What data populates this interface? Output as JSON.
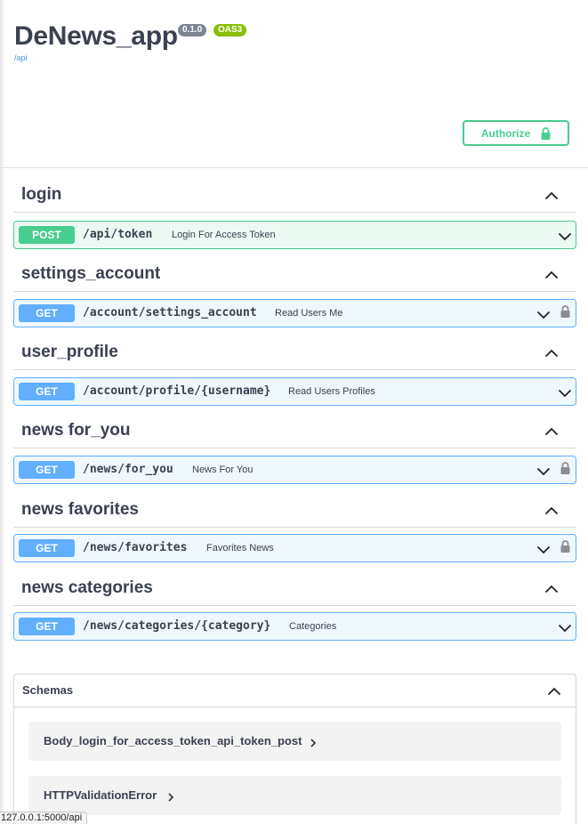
{
  "info": {
    "title": "DeNews_app",
    "version": "0.1.0",
    "oas": "OAS3",
    "base_url": "/api"
  },
  "authorize": {
    "label": "Authorize",
    "icon": "lock-icon"
  },
  "tags": [
    {
      "name": "login",
      "operations": [
        {
          "method": "POST",
          "path": "/api/token",
          "summary": "Login For Access Token",
          "locked": false
        }
      ]
    },
    {
      "name": "settings_account",
      "operations": [
        {
          "method": "GET",
          "path": "/account/settings_account",
          "summary": "Read Users Me",
          "locked": true
        }
      ]
    },
    {
      "name": "user_profile",
      "operations": [
        {
          "method": "GET",
          "path": "/account/profile/{username}",
          "summary": "Read Users Profiles",
          "locked": false
        }
      ]
    },
    {
      "name": "news for_you",
      "operations": [
        {
          "method": "GET",
          "path": "/news/for_you",
          "summary": "News For You",
          "locked": true
        }
      ]
    },
    {
      "name": "news favorites",
      "operations": [
        {
          "method": "GET",
          "path": "/news/favorites",
          "summary": "Favorites News",
          "locked": true
        }
      ]
    },
    {
      "name": "news categories",
      "operations": [
        {
          "method": "GET",
          "path": "/news/categories/{category}",
          "summary": "Categories",
          "locked": false
        }
      ]
    }
  ],
  "schemas": {
    "title": "Schemas",
    "models": [
      "Body_login_for_access_token_api_token_post",
      "HTTPValidationError"
    ]
  },
  "status_bar": {
    "url": "127.0.0.1:5000/api"
  },
  "colors": {
    "post": "#49cc90",
    "get": "#61affe",
    "text": "#3b4151",
    "authorize": "#49cc90"
  }
}
